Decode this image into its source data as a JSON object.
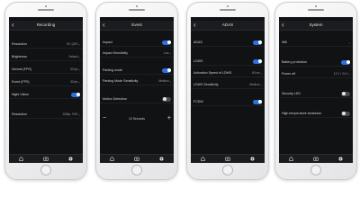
{
  "colors": {
    "accent": "#2f6fe0",
    "screen_bg": "#111214",
    "bar_bg": "#1b1c1f"
  },
  "nav": {
    "back_glyph": "‹"
  },
  "screens": [
    {
      "title": "Recording",
      "rows": [
        {
          "label": "Resolution",
          "value": "2K, QHD"
        },
        {
          "label": "Brightness",
          "value": "Default"
        },
        {
          "label": "Normal (FPS)",
          "value": "30 fps"
        },
        {
          "label": "Event (FPS)",
          "value": "30 fps"
        },
        {
          "label": "Night Vision",
          "value": ""
        },
        {
          "label": "Resolution",
          "value": "1080p, FHD"
        }
      ]
    },
    {
      "title": "Event",
      "rows": [
        {
          "label": "Impact",
          "value": ""
        },
        {
          "label": "Impact Sensitivity",
          "value": "Low"
        },
        {
          "label": "Parking mode",
          "value": ""
        },
        {
          "label": "Parking Mode Sensitivity",
          "value": "Medium"
        },
        {
          "label": "Motion Detection",
          "value": ""
        }
      ],
      "stepper": {
        "minus": "−",
        "value": "10 Seconds",
        "plus": "+"
      }
    },
    {
      "title": "ADAS",
      "rows": [
        {
          "label": "ADAS",
          "value": ""
        },
        {
          "label": "LDWS",
          "value": ""
        },
        {
          "label": "Activation Speed of LDWS",
          "value": "60 km"
        },
        {
          "label": "LDWS Sensitivity",
          "value": "Medium"
        },
        {
          "label": "FCDW",
          "value": ""
        }
      ]
    },
    {
      "title": "System",
      "rows": [
        {
          "label": "Wifi",
          "value": ""
        },
        {
          "label": "Battery protection",
          "value": ""
        },
        {
          "label": "Power off",
          "value": "12 V / 24 V"
        },
        {
          "label": "Security LED",
          "value": ""
        },
        {
          "label": "High temperature shutdown",
          "value": ""
        }
      ]
    }
  ],
  "tabbar": {
    "icons": [
      "home-icon",
      "camera-icon",
      "settings-icon"
    ]
  }
}
